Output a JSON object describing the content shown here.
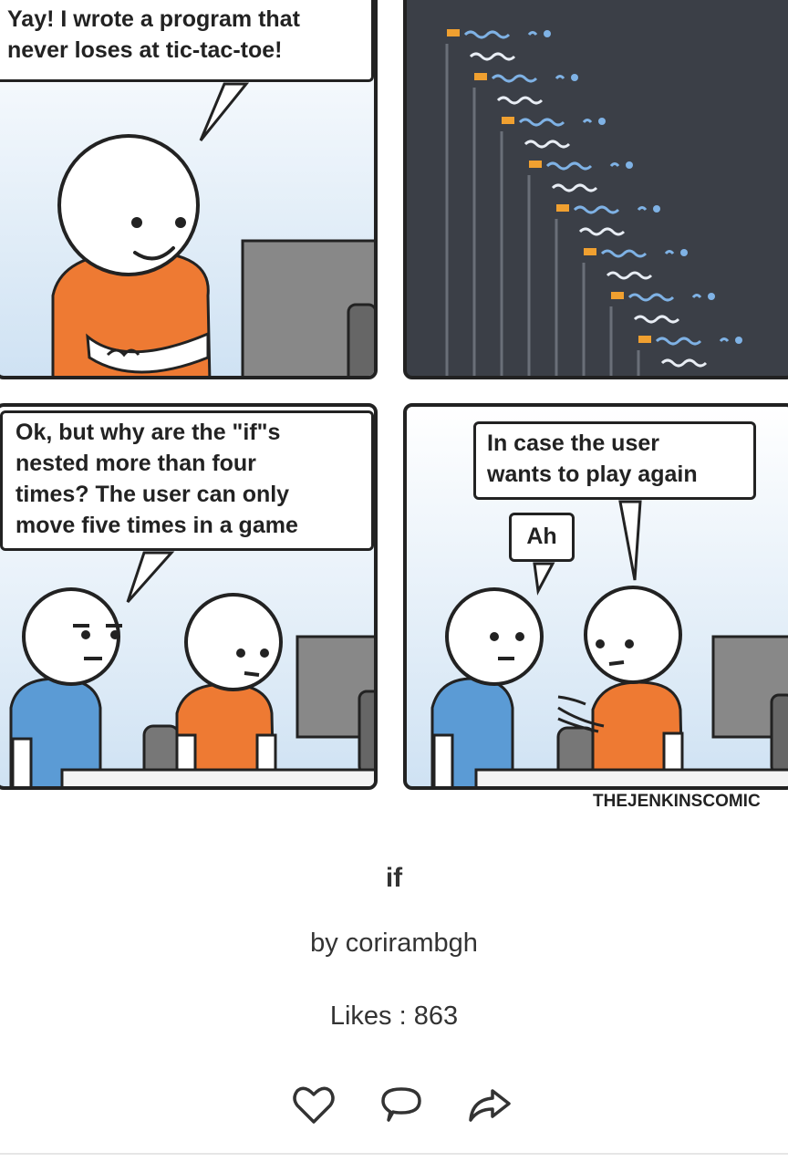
{
  "comic": {
    "panel1_speech": "Yay! I wrote a program that\nnever loses at tic-tac-toe!",
    "panel3_speech": "Ok, but why are the \"if\"s\nnested more than four\ntimes? The user can only\nmove five times in a game",
    "panel4_speech_right": "In case the user\nwants to play again",
    "panel4_speech_left": "Ah",
    "credit": "THEJENKINSCOMIC"
  },
  "post": {
    "title": "if",
    "author": "by corirambgh",
    "likes": "Likes : 863"
  },
  "actions": {
    "icons": [
      "heart-icon",
      "comment-icon",
      "share-icon"
    ]
  },
  "colors": {
    "shirt_orange": "#ee7a33",
    "shirt_blue": "#5b9bd5",
    "code_bg": "#3b3f47",
    "code_blue": "#7fb2e5",
    "code_orange": "#f0a030"
  }
}
